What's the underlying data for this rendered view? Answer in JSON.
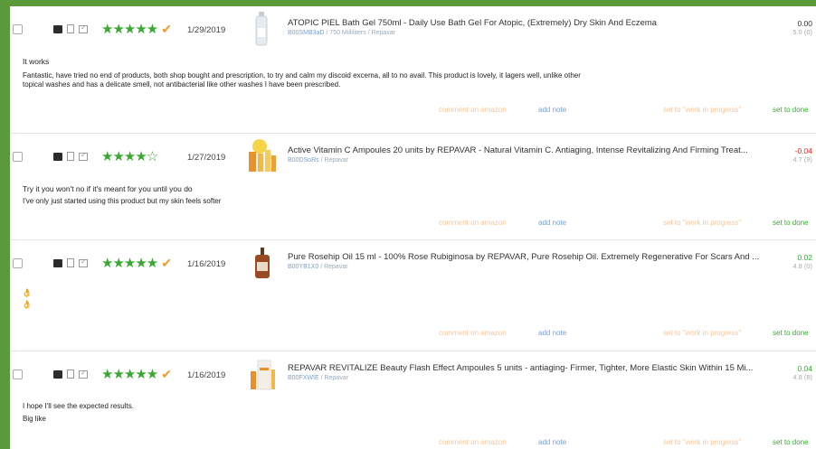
{
  "actions": {
    "comment": "comment on amazon",
    "note": "add note",
    "wip": "set to \"work in progress\"",
    "done": "set to done"
  },
  "reviews": [
    {
      "stars": 5,
      "date": "1/29/2019",
      "product_title": "ATOPIC PIEL Bath Gel 750ml - Daily Use Bath Gel For Atopic, (Extremely) Dry Skin And Eczema",
      "asin": "B00SMB3aD",
      "meta_rest": " / 750 Milliliters / Repavar",
      "score": "0.00",
      "score_sub": "5.0 (0)",
      "score_color": "#333333",
      "review_title": "It works",
      "review_text": "Fantastic, have tried no end of products, both shop bought and prescription, to try and calm my discoid excema, all to no avail. This product is lovely, it lagers well, unlike other topical washes and has a delicate smell, not antibacterial like other washes I have been prescribed."
    },
    {
      "stars": 4,
      "date": "1/27/2019",
      "product_title": "Active Vitamin C Ampoules 20 units by REPAVAR - Natural Vitamin C. Antiaging, Intense Revitalizing And Firming Treat...",
      "asin": "B00DSoRs",
      "meta_rest": " / Repavar",
      "score": "-0.04",
      "score_sub": "4.7 (9)",
      "score_color": "#e0302a",
      "review_title": "Try it you won't no if it's meant for you until you do",
      "review_text": "I've only just started using this product but my skin feels softer"
    },
    {
      "stars": 5,
      "date": "1/16/2019",
      "product_title": "Pure Rosehip Oil 15 ml - 100% Rose Rubiginosa by REPAVAR, Pure Rosehip Oil. Extremely Regenerative For Scars And ...",
      "asin": "B00YB1X0",
      "meta_rest": " / Repavar",
      "score": "0.02",
      "score_sub": "4.8 (0)",
      "score_color": "#3aa832",
      "review_title": "",
      "review_text": "",
      "emoji_lines": [
        "👌",
        "👌"
      ]
    },
    {
      "stars": 5,
      "date": "1/16/2019",
      "product_title": "REPAVAR REVITALIZE Beauty Flash Effect Ampoules 5 units - antiaging- Firmer, Tighter, More Elastic Skin Within 15 Mi...",
      "asin": "B00FXWIE",
      "meta_rest": " / Repavar",
      "score": "0.04",
      "score_sub": "4.8 (8)",
      "score_color": "#3aa832",
      "review_title": "I hope I'll see the expected results.",
      "review_text": "Big like"
    }
  ]
}
